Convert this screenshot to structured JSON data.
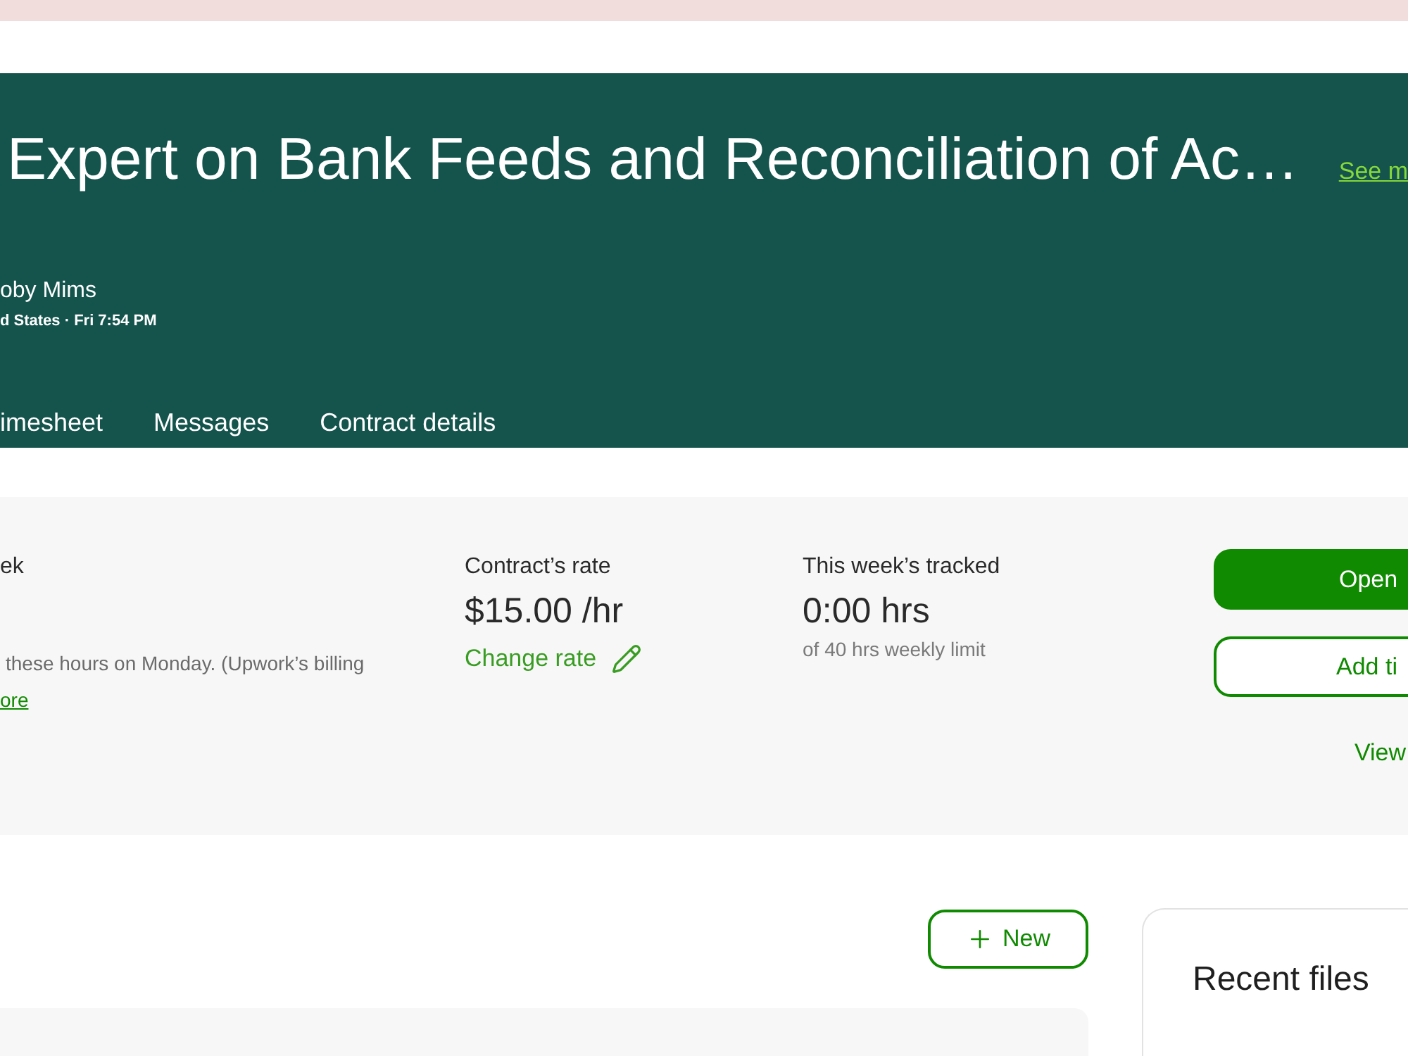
{
  "header": {
    "title": "Expert on Bank Feeds and Reconciliation of Ac…",
    "see_more_link": "See m",
    "client_name": "oby Mims",
    "client_meta": "d States · Fri 7:54 PM",
    "tabs": [
      {
        "label": "imesheet",
        "selected": false
      },
      {
        "label": "Messages",
        "selected": false
      },
      {
        "label": "Contract details",
        "selected": false
      }
    ]
  },
  "summary": {
    "week": {
      "label": "ek",
      "note": "these hours on Monday. (Upwork’s billing",
      "link": "ore"
    },
    "rate": {
      "label": "Contract’s rate",
      "value": "$15.00 /hr",
      "action": "Change rate"
    },
    "tracked": {
      "label": "This week’s tracked",
      "value": "0:00 hrs",
      "limit": "of 40 hrs weekly limit"
    },
    "actions": [
      {
        "label": "Open",
        "kind": "primary"
      },
      {
        "label": "Add ti",
        "kind": "outline"
      },
      {
        "label": "View",
        "kind": "text"
      }
    ]
  },
  "new_button": {
    "label": "New"
  },
  "recent_files": {
    "title": "Recent files"
  }
}
